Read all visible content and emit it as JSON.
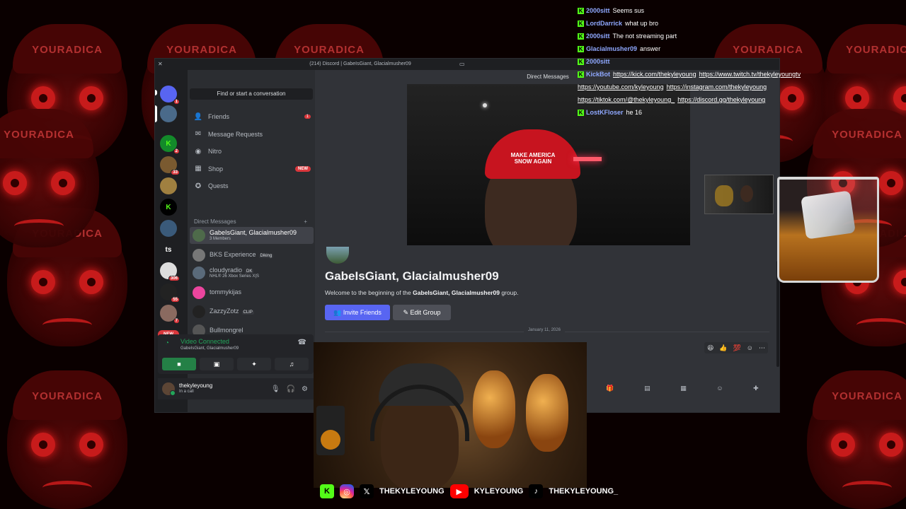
{
  "window": {
    "title": "(214) Discord | GabeIsGiant, Glacialmusher09",
    "header": "Direct Messages"
  },
  "colors": {
    "discord_bg": "#1e1f22",
    "sidebar": "#2b2d31",
    "main": "#313338",
    "blurple": "#5865f2",
    "green": "#23a55a",
    "red": "#da373c",
    "kick_green": "#53fc18"
  },
  "servers": [
    {
      "label": "",
      "badge": "1",
      "icon": "discord-logo-icon"
    },
    {
      "label": "",
      "badge": "",
      "icon": "server-avatar-icon"
    },
    {
      "label": "K",
      "badge": "2",
      "icon": "kick-server-icon"
    },
    {
      "label": "",
      "badge": "33",
      "icon": "server-avatar-icon"
    },
    {
      "label": "",
      "badge": "",
      "icon": "server-avatar-icon"
    },
    {
      "label": "K",
      "badge": "",
      "icon": "kick-server-icon"
    },
    {
      "label": "",
      "badge": "",
      "icon": "server-avatar-icon"
    },
    {
      "label": "ts",
      "badge": "",
      "icon": "text-server-icon"
    },
    {
      "label": "",
      "badge": "306",
      "icon": "server-avatar-icon"
    },
    {
      "label": "",
      "badge": "55",
      "icon": "server-avatar-icon"
    },
    {
      "label": "",
      "badge": "7",
      "icon": "server-avatar-icon"
    }
  ],
  "servers_new_label": "NEW",
  "search_placeholder": "Find or start a conversation",
  "nav": [
    {
      "label": "Friends",
      "icon": "friends-icon",
      "count": "1",
      "tag": ""
    },
    {
      "label": "Message Requests",
      "icon": "mail-icon",
      "count": "",
      "tag": ""
    },
    {
      "label": "Nitro",
      "icon": "nitro-icon",
      "count": "",
      "tag": ""
    },
    {
      "label": "Shop",
      "icon": "shop-icon",
      "count": "",
      "tag": "NEW"
    },
    {
      "label": "Quests",
      "icon": "quests-icon",
      "count": "",
      "tag": ""
    }
  ],
  "dm_header": "Direct Messages",
  "dms": [
    {
      "name": "GabeIsGiant, Glacialmusher09",
      "sub": "3 Members",
      "tag": "",
      "color": "#4e6a4a",
      "active": true
    },
    {
      "name": "BKS Experience",
      "sub": "",
      "tag": "Diking",
      "color": "#777",
      "active": false
    },
    {
      "name": "cloudyradio",
      "sub": "NHL® 26 Xbox Series X|S",
      "tag": "DK",
      "color": "#5a6a7a",
      "active": false
    },
    {
      "name": "tommykijas",
      "sub": "",
      "tag": "",
      "color": "#eb459e",
      "active": false
    },
    {
      "name": "ZazzyZotz",
      "sub": "",
      "tag": "CLIP",
      "color": "#222",
      "active": false
    },
    {
      "name": "Bullmongrel",
      "sub": "",
      "tag": "",
      "color": "#555",
      "active": false
    }
  ],
  "voice": {
    "status": "Video Connected",
    "channel": "GabeIsGiant, Glacialmusher09"
  },
  "user": {
    "name": "thekyleyoung",
    "status": "In a call"
  },
  "group": {
    "title": "GabeIsGiant, Glacialmusher09",
    "welcome_prefix": "Welcome to the beginning of the ",
    "welcome_name": "GabeIsGiant, Glacialmusher09",
    "welcome_suffix": " group.",
    "invite_label": "Invite Friends",
    "edit_label": "Edit Group",
    "date": "January 11, 2026"
  },
  "video": {
    "hat_text": "MAKE AMERICA SNOW AGAIN"
  },
  "chat": [
    {
      "user": "2000sitt",
      "color": "#8fa8ff",
      "text": "Seems sus",
      "links": []
    },
    {
      "user": "LordDarrick",
      "color": "#8fa8ff",
      "text": "what up bro",
      "links": []
    },
    {
      "user": "2000sitt",
      "color": "#8fa8ff",
      "text": "The not streaming part",
      "links": []
    },
    {
      "user": "Glacialmusher09",
      "color": "#8fa8ff",
      "text": "answer",
      "links": []
    },
    {
      "user": "2000sitt",
      "color": "#8fa8ff",
      "text": "",
      "links": []
    },
    {
      "user": "KickBot",
      "color": "#8fa8ff",
      "text": "",
      "links": [
        "https://kick.com/thekyleyoung",
        "https://www.twitch.tv/thekyleyoungtv"
      ]
    },
    {
      "user": "",
      "color": "#8fa8ff",
      "text": "",
      "links": [
        "https://youtube.com/kyleyoung",
        "https://instagram.com/thekyleyoung"
      ]
    },
    {
      "user": "",
      "color": "#8fa8ff",
      "text": "",
      "links": [
        "https://tiktok.com/@thekyleyoung_",
        "https://discord.gg/thekyleyoung"
      ]
    },
    {
      "user": "LostKFloser",
      "color": "#8fa8ff",
      "text": "he 16",
      "links": []
    }
  ],
  "socials": [
    {
      "icon": "kick-icon",
      "glyph": "K",
      "handle": ""
    },
    {
      "icon": "instagram-icon",
      "glyph": "◎",
      "handle": ""
    },
    {
      "icon": "x-icon",
      "glyph": "𝕏",
      "handle": "THEKYLEYOUNG"
    },
    {
      "icon": "youtube-icon",
      "glyph": "▶",
      "handle": "KYLEYOUNG"
    },
    {
      "icon": "tiktok-icon",
      "glyph": "♪",
      "handle": "THEKYLEYOUNG_"
    }
  ],
  "bg_cap_text": "YOURADICA"
}
